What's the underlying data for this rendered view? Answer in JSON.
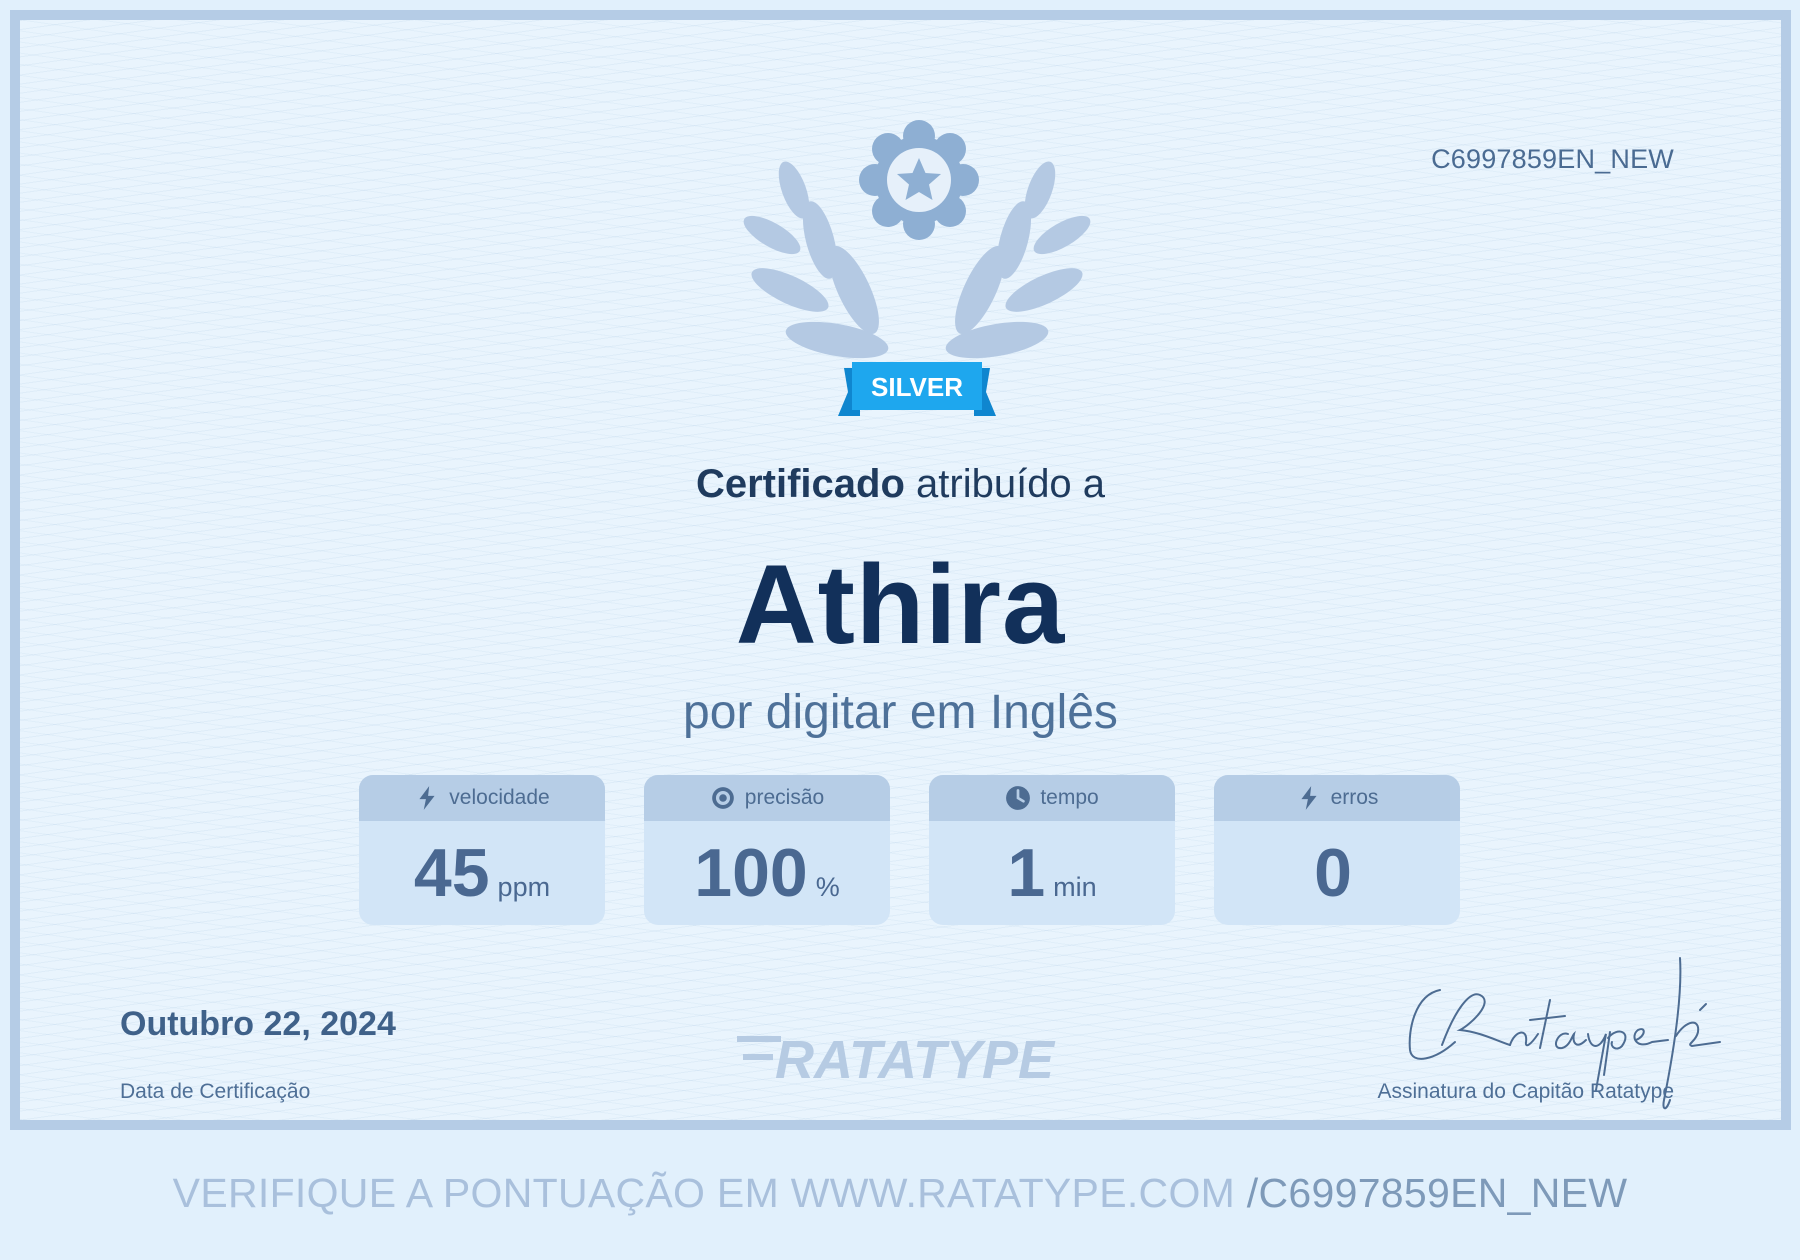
{
  "certificate": {
    "id": "C6997859EN_NEW",
    "badge": "SILVER",
    "heading_bold": "Certificado",
    "heading_rest": "atribuído a",
    "recipient": "Athira",
    "subtitle": "por digitar em Inglês"
  },
  "stats": [
    {
      "icon": "lightning-icon",
      "label": "velocidade",
      "value": "45",
      "unit": "ppm"
    },
    {
      "icon": "target-icon",
      "label": "precisão",
      "value": "100",
      "unit": "%"
    },
    {
      "icon": "clock-icon",
      "label": "tempo",
      "value": "1",
      "unit": "min"
    },
    {
      "icon": "lightning-icon",
      "label": "erros",
      "value": "0",
      "unit": ""
    }
  ],
  "footer": {
    "date": "Outubro 22, 2024",
    "date_label": "Data de Certificação",
    "logo_text": "RATATYPE",
    "signature_label": "Assinatura do Capitão Ratatype",
    "signature_text": "CRatatype-fé"
  },
  "verify": {
    "text": "VERIFIQUE A PONTUAÇÃO EM WWW.RATATYPE.COM ",
    "code": "/C6997859EN_NEW"
  },
  "colors": {
    "background": "#e1f0fc",
    "border": "#b5cce6",
    "badge": "#1ea7ee",
    "name": "#12305a",
    "stat_card": "#d2e5f7"
  }
}
